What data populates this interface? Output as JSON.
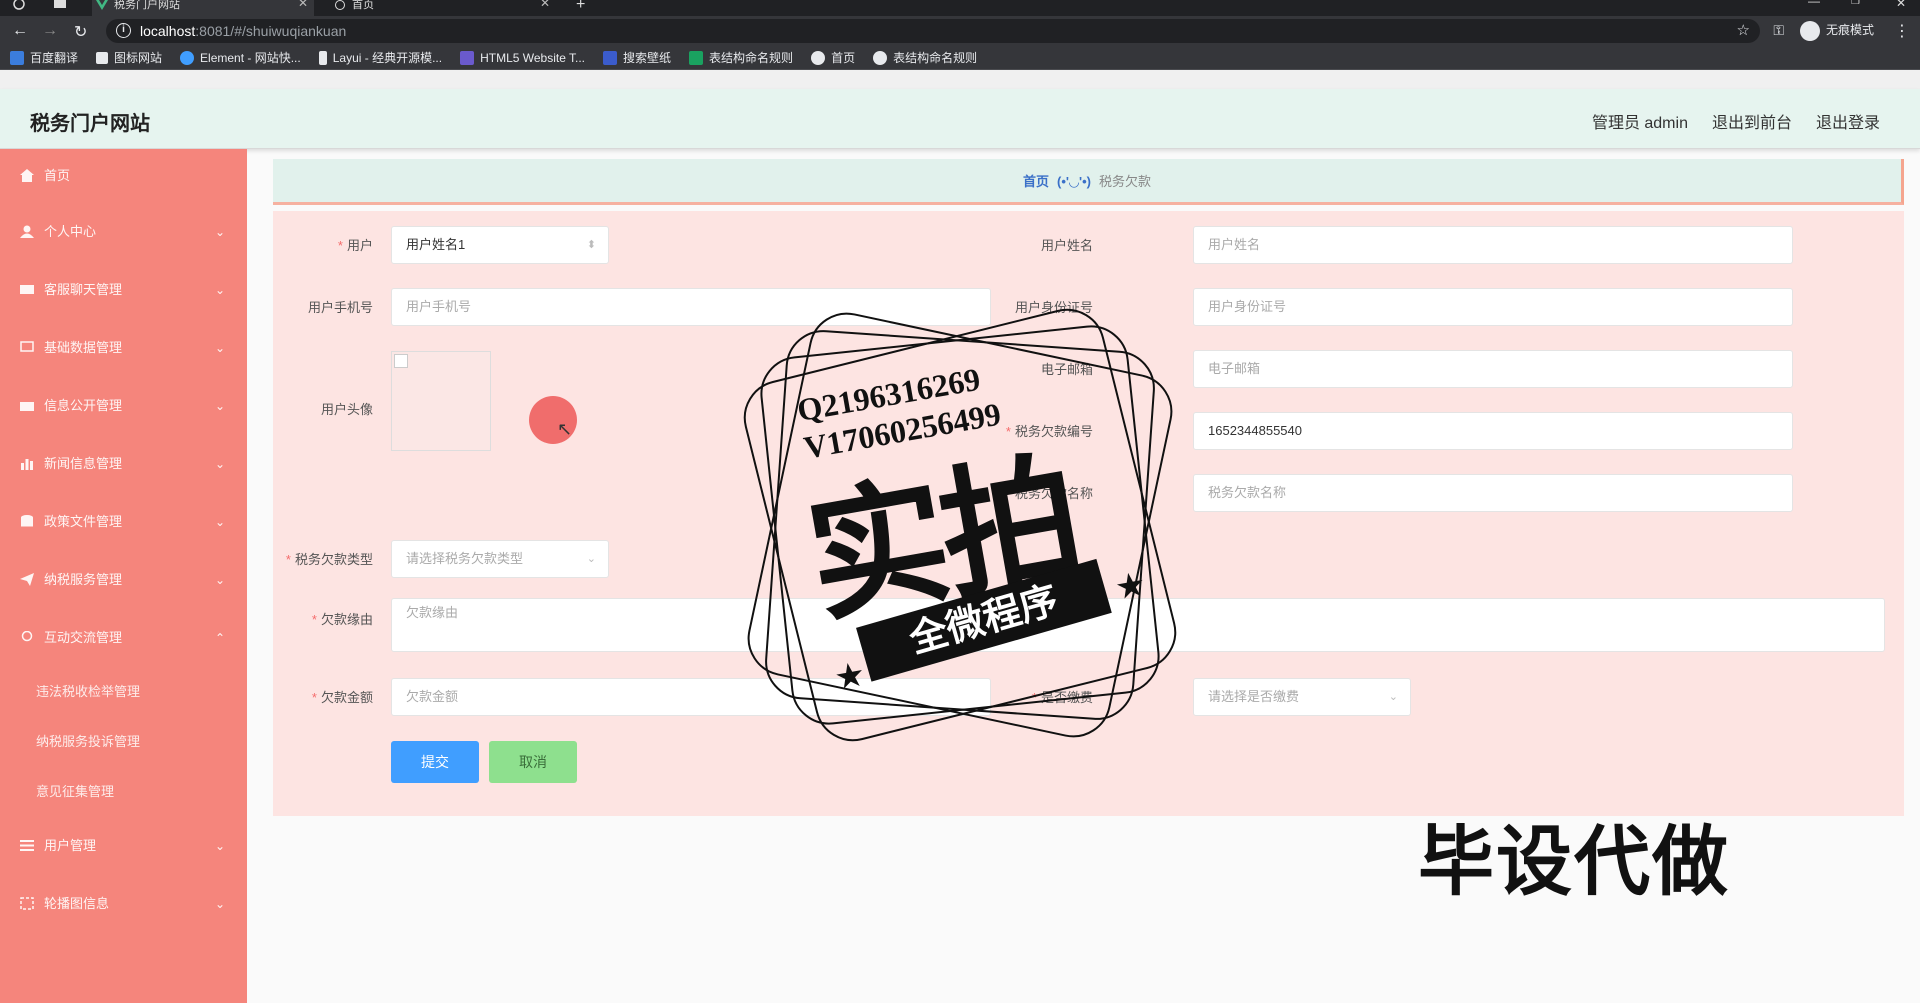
{
  "browser": {
    "tabs": [
      {
        "label": "税务门户网站",
        "active": true
      },
      {
        "label": "首页",
        "active": false
      }
    ],
    "url_host": "localhost",
    "url_path": ":8081/#/shuiwuqiankuan",
    "incognito_label": "无痕模式",
    "bookmarks": [
      {
        "label": "百度翻译",
        "color": "#3b7ddd"
      },
      {
        "label": "图标网站",
        "color": "#e8eaed"
      },
      {
        "label": "Element - 网站快...",
        "color": "#409eff"
      },
      {
        "label": "Layui - 经典开源模...",
        "color": "#e8eaed"
      },
      {
        "label": "HTML5 Website T...",
        "color": "#6a5acd"
      },
      {
        "label": "搜索壁纸",
        "color": "#3b5ccc"
      },
      {
        "label": "表结构命名规则",
        "color": "#1aa260"
      },
      {
        "label": "首页",
        "color": "#e8eaed"
      },
      {
        "label": "表结构命名规则",
        "color": "#e8eaed"
      }
    ]
  },
  "header": {
    "title": "税务门户网站",
    "admin": "管理员 admin",
    "to_front": "退出到前台",
    "logout": "退出登录"
  },
  "sidebar": {
    "home": "首页",
    "items": [
      {
        "label": "个人中心"
      },
      {
        "label": "客服聊天管理"
      },
      {
        "label": "基础数据管理"
      },
      {
        "label": "信息公开管理"
      },
      {
        "label": "新闻信息管理"
      },
      {
        "label": "政策文件管理"
      },
      {
        "label": "纳税服务管理"
      },
      {
        "label": "互动交流管理"
      }
    ],
    "subitems": [
      {
        "label": "违法税收检举管理"
      },
      {
        "label": "纳税服务投诉管理"
      },
      {
        "label": "意见征集管理"
      }
    ],
    "items_bottom": [
      {
        "label": "用户管理"
      },
      {
        "label": "轮播图信息"
      }
    ]
  },
  "breadcrumb": {
    "home": "首页",
    "emoji": "(•'◡'•)",
    "current": "税务欠款"
  },
  "form": {
    "user_label": "用户",
    "user_value": "用户姓名1",
    "user_name_label": "用户姓名",
    "user_name_placeholder": "用户姓名",
    "phone_label": "用户手机号",
    "phone_placeholder": "用户手机号",
    "idcard_label": "用户身份证号",
    "idcard_placeholder": "用户身份证号",
    "avatar_label": "用户头像",
    "email_label": "电子邮箱",
    "email_placeholder": "电子邮箱",
    "debt_no_label": "税务欠款编号",
    "debt_no_value": "1652344855540",
    "debt_name_label": "税务欠款名称",
    "debt_name_placeholder": "税务欠款名称",
    "debt_type_label": "税务欠款类型",
    "debt_type_placeholder": "请选择税务欠款类型",
    "reason_label": "欠款缘由",
    "reason_placeholder": "欠款缘由",
    "amount_label": "欠款金额",
    "amount_placeholder": "欠款金额",
    "paid_label": "是否缴费",
    "paid_placeholder": "请选择是否缴费",
    "submit": "提交",
    "cancel": "取消"
  },
  "overlay": {
    "contact_q": "Q2196316269",
    "contact_v": "V17060256499",
    "big": "实拍",
    "ribbon": "全微程序",
    "bisheng": "毕设代做"
  }
}
